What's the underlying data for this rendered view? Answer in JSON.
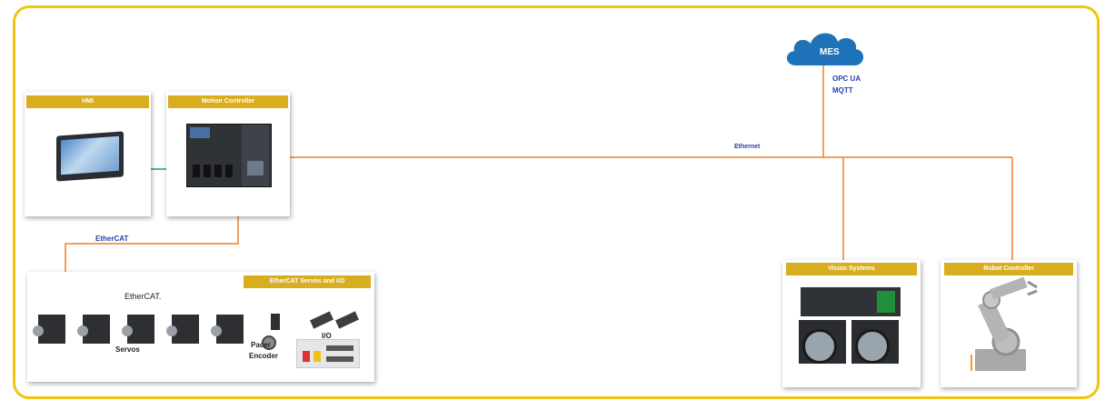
{
  "cloud": {
    "label": "MES",
    "icon": "cloud-icon",
    "color": "#1e73b8"
  },
  "protocols": {
    "opc_ua": "OPC UA",
    "mqtt": "MQTT"
  },
  "networks": {
    "ethernet": "Ethernet",
    "ethercat": "EtherCAT",
    "ethercat_logo": "EtherCAT."
  },
  "cards": {
    "hmi": "HMI",
    "motion_controller": "Motion Controller",
    "servos_io": "EtherCAT Servos and I/O",
    "vision_systems": "Vision Systems",
    "robot_controller": "Robot Controller"
  },
  "devices": {
    "servos": "Servos",
    "pacer": "Pacer",
    "encoder": "Encoder",
    "io": "I/O"
  },
  "colors": {
    "frame": "#f2c40f",
    "header": "#d8ad1f",
    "ethernet_wire": "#f07f28",
    "hmi_link": "#2ea043",
    "label_blue": "#2b3fa8"
  }
}
